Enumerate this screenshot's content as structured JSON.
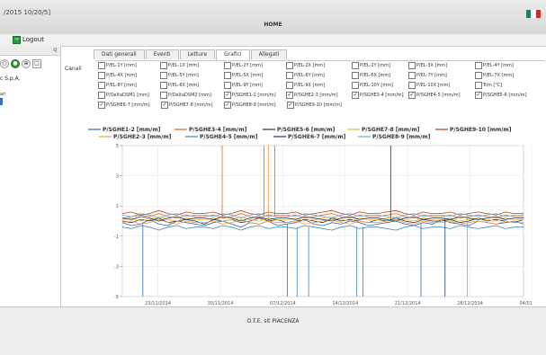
{
  "app": {
    "version": "/2015 10/20/5]",
    "home": "HOME",
    "flag_colors": [
      "#009246",
      "#ffffff",
      "#ce2b37"
    ]
  },
  "toolbar": {
    "cut_label": "i",
    "logout_label": "Logout"
  },
  "sidebar": {
    "close_glyph": "q",
    "tools": [
      "○",
      "●",
      "⊕",
      "□"
    ],
    "company": "c S.p.A.",
    "sub_label": "ari"
  },
  "tabs": [
    "Dati generali",
    "Eventi",
    "Letture",
    "Grafici",
    "Allegati"
  ],
  "active_tab": "Grafici",
  "channels": {
    "label": "Canali",
    "rows": [
      [
        {
          "label": "P/EL-1Y [mm]",
          "checked": false
        },
        {
          "label": "P/EL-1X [mm]",
          "checked": false
        },
        {
          "label": "P/EL-2Y [mm]",
          "checked": false
        },
        {
          "label": "P/EL-2X [mm]",
          "checked": false
        },
        {
          "label": "P/EL-2Y [mm]",
          "checked": false
        },
        {
          "label": "P/EL-3X [mm]",
          "checked": false
        },
        {
          "label": "P/EL-4Y [mm]",
          "checked": false
        }
      ],
      [
        {
          "label": "P/EL-4X [mm]",
          "checked": false
        },
        {
          "label": "P/EL-5Y [mm]",
          "checked": false
        },
        {
          "label": "P/EL-5X [mm]",
          "checked": false
        },
        {
          "label": "P/EL-6Y [mm]",
          "checked": false
        },
        {
          "label": "P/EL-6X [mm]",
          "checked": false
        },
        {
          "label": "P/EL-7Y [mm]",
          "checked": false
        },
        {
          "label": "P/EL-7X [mm]",
          "checked": false
        }
      ],
      [
        {
          "label": "P/EL-8Y [mm]",
          "checked": false
        },
        {
          "label": "P/EL-8X [mm]",
          "checked": false
        },
        {
          "label": "P/EL-9Y [mm]",
          "checked": false
        },
        {
          "label": "P/EL-9X [mm]",
          "checked": false
        },
        {
          "label": "P/EL-10Y [mm]",
          "checked": false
        },
        {
          "label": "P/EL-10X [mm]",
          "checked": false
        },
        {
          "label": "Tcm [°C]",
          "checked": false
        }
      ],
      [
        {
          "label": "P/DeltaDSM1 [mm]",
          "checked": false
        },
        {
          "label": "P/DeltaDSM2 [mm]",
          "checked": false
        },
        {
          "label": "P/SGHE1-2 [mm/m]",
          "checked": true
        },
        {
          "label": "P/SGHE2-3 [mm/m]",
          "checked": true
        },
        {
          "label": "P/SGHE3-4 [mm/m]",
          "checked": true
        },
        {
          "label": "P/SGHE4-5 [mm/m]",
          "checked": true
        },
        {
          "label": "P/SGHE5-6 [mm/m]",
          "checked": true
        }
      ],
      [
        {
          "label": "P/SGHE6-7 [mm/m]",
          "checked": true
        },
        {
          "label": "P/SGHE7-8 [mm/m]",
          "checked": true
        },
        {
          "label": "P/SGHE8-9 [mm/m]",
          "checked": true
        },
        {
          "label": "P/SGHE9-10 [mm/m]",
          "checked": true
        }
      ]
    ]
  },
  "chart_data": {
    "type": "line",
    "title": "",
    "xlabel": "",
    "ylabel": "",
    "ylim": [
      -5,
      5
    ],
    "yticks": [
      -5,
      -3,
      -1,
      1,
      3,
      5
    ],
    "x_tick_labels": [
      "23/11/2014",
      "30/11/2014",
      "07/12/2014",
      "14/12/2014",
      "21/12/2014",
      "28/12/2014",
      "04/01/2015"
    ],
    "grid": true,
    "legend_position": "top",
    "legend_rows": [
      [
        "P/SGHE1-2 [mm/m]",
        "P/SGHE3-4 [mm/m]",
        "P/SGHE5-6 [mm/m]",
        "P/SGHE7-8 [mm/m]",
        "P/SGHE9-10 [mm/m]"
      ],
      [
        "P/SGHE2-3 [mm/m]",
        "P/SGHE4-5 [mm/m]",
        "P/SGHE6-7 [mm/m]",
        "P/SGHE8-9 [mm/m]"
      ]
    ],
    "series": [
      {
        "name": "P/SGHE1-2 [mm/m]",
        "color": "#2b6cb0",
        "base": -0.2,
        "spikes": [
          {
            "day": 2.3,
            "to": -5
          },
          {
            "day": 18.5,
            "to": -5
          },
          {
            "day": 33.5,
            "to": -5
          }
        ],
        "values": [
          -0.1,
          -0.3,
          -0.2,
          0.1,
          -0.2,
          -0.3,
          0.0,
          -0.1,
          -0.2,
          -0.3,
          -0.1,
          0.0,
          -0.2,
          -0.4,
          -0.1,
          -0.2,
          0.0,
          -0.3,
          -0.2,
          -0.1,
          0.1,
          -0.2,
          -0.3,
          -0.1,
          -0.2,
          0.0,
          -0.1,
          -0.3,
          -0.2,
          -0.1,
          0.0,
          -0.2,
          -0.3,
          -0.1,
          -0.2,
          0.1,
          -0.1,
          -0.2,
          -0.3,
          0.0,
          -0.1,
          -0.2,
          -0.1,
          0.0,
          -0.2
        ]
      },
      {
        "name": "P/SGHE3-4 [mm/m]",
        "color": "#e0642a",
        "base": 0.3,
        "spikes": [
          {
            "day": 11.2,
            "to": 5
          },
          {
            "day": 15.9,
            "to": 5
          },
          {
            "day": 17.1,
            "to": 5
          }
        ],
        "values": [
          0.2,
          0.3,
          0.4,
          0.3,
          0.5,
          0.3,
          0.2,
          0.4,
          0.3,
          0.3,
          0.4,
          0.2,
          0.3,
          0.5,
          0.3,
          0.2,
          0.4,
          0.3,
          0.3,
          0.4,
          0.2,
          0.3,
          0.4,
          0.5,
          0.3,
          0.2,
          0.4,
          0.3,
          0.3,
          0.4,
          0.5,
          0.3,
          0.2,
          0.4,
          0.3,
          0.3,
          0.4,
          0.2,
          0.3,
          0.4,
          0.3,
          0.2,
          0.4,
          0.3,
          0.3
        ]
      },
      {
        "name": "P/SGHE5-6 [mm/m]",
        "color": "#333333",
        "base": 0.0,
        "spikes": [
          {
            "day": 30.1,
            "to": 5
          }
        ],
        "values": [
          0.0,
          -0.1,
          0.1,
          0.0,
          0.2,
          -0.1,
          0.0,
          0.1,
          0.0,
          -0.2,
          0.1,
          0.0,
          0.1,
          -0.1,
          0.0,
          0.2,
          0.0,
          0.1,
          -0.1,
          0.0,
          0.1,
          0.0,
          -0.1,
          0.2,
          0.0,
          0.1,
          0.0,
          -0.1,
          0.1,
          0.0,
          0.2,
          0.0,
          -0.1,
          0.1,
          0.0,
          0.0,
          0.1,
          -0.1,
          0.0,
          0.2,
          0.0,
          0.1,
          0.0,
          -0.1,
          0.1
        ]
      },
      {
        "name": "P/SGHE7-8 [mm/m]",
        "color": "#e3b341",
        "base": 0.1,
        "spikes": [],
        "values": [
          0.1,
          0.2,
          0.0,
          0.1,
          0.3,
          0.1,
          0.0,
          0.2,
          0.1,
          0.1,
          0.2,
          0.0,
          0.1,
          0.3,
          0.1,
          0.0,
          0.2,
          0.1,
          0.1,
          0.2,
          0.0,
          0.1,
          0.2,
          0.3,
          0.1,
          0.0,
          0.2,
          0.1,
          0.1,
          0.2,
          0.3,
          0.1,
          0.0,
          0.2,
          0.1,
          0.1,
          0.2,
          0.0,
          0.1,
          0.2,
          0.1,
          0.0,
          0.2,
          0.1,
          0.1
        ]
      },
      {
        "name": "P/SGHE9-10 [mm/m]",
        "color": "#b7410e",
        "base": 0.5,
        "spikes": [],
        "values": [
          0.5,
          0.6,
          0.4,
          0.5,
          0.7,
          0.5,
          0.4,
          0.6,
          0.5,
          0.5,
          0.6,
          0.4,
          0.5,
          0.7,
          0.5,
          0.4,
          0.6,
          0.5,
          0.5,
          0.6,
          0.4,
          0.5,
          0.6,
          0.7,
          0.5,
          0.4,
          0.6,
          0.5,
          0.5,
          0.6,
          0.7,
          0.5,
          0.4,
          0.6,
          0.5,
          0.5,
          0.6,
          0.4,
          0.5,
          0.6,
          0.5,
          0.4,
          0.6,
          0.5,
          0.5
        ]
      },
      {
        "name": "P/SGHE2-3 [mm/m]",
        "color": "#f29d38",
        "base": -0.1,
        "spikes": [
          {
            "day": 16.4,
            "to": 5
          }
        ],
        "values": [
          -0.1,
          0.0,
          -0.2,
          -0.1,
          0.1,
          -0.1,
          -0.2,
          0.0,
          -0.1,
          -0.1,
          0.0,
          -0.2,
          -0.1,
          0.1,
          -0.1,
          -0.2,
          0.0,
          -0.1,
          -0.1,
          0.0,
          -0.2,
          -0.1,
          0.0,
          0.1,
          -0.1,
          -0.2,
          0.0,
          -0.1,
          -0.1,
          0.0,
          0.1,
          -0.1,
          -0.2,
          0.0,
          -0.1,
          -0.1,
          0.0,
          -0.2,
          -0.1,
          0.0,
          -0.1,
          -0.2,
          0.0,
          -0.1,
          -0.1
        ]
      },
      {
        "name": "P/SGHE4-5 [mm/m]",
        "color": "#3b82c4",
        "base": -0.4,
        "spikes": [
          {
            "day": 19.6,
            "to": -5
          },
          {
            "day": 20.9,
            "to": -5
          },
          {
            "day": 26.3,
            "to": -5
          },
          {
            "day": 27.0,
            "to": -5
          }
        ],
        "values": [
          -0.4,
          -0.5,
          -0.3,
          -0.4,
          -0.6,
          -0.4,
          -0.3,
          -0.5,
          -0.4,
          -0.4,
          -0.5,
          -0.3,
          -0.4,
          -0.6,
          -0.4,
          -0.3,
          -0.5,
          -0.4,
          -0.4,
          -0.5,
          -0.3,
          -0.4,
          -0.5,
          -0.6,
          -0.4,
          -0.3,
          -0.5,
          -0.4,
          -0.4,
          -0.5,
          -0.6,
          -0.4,
          -0.3,
          -0.5,
          -0.4,
          -0.4,
          -0.5,
          -0.3,
          -0.4,
          -0.5,
          -0.4,
          -0.3,
          -0.5,
          -0.4,
          -0.4
        ]
      },
      {
        "name": "P/SGHE6-7 [mm/m]",
        "color": "#1f3b63",
        "base": 0.2,
        "spikes": [
          {
            "day": 36.2,
            "to": -5
          }
        ],
        "values": [
          0.2,
          0.1,
          0.3,
          0.2,
          0.0,
          0.2,
          0.3,
          0.1,
          0.2,
          0.2,
          0.1,
          0.3,
          0.2,
          0.0,
          0.2,
          0.3,
          0.1,
          0.2,
          0.2,
          0.1,
          0.3,
          0.2,
          0.1,
          0.0,
          0.2,
          0.3,
          0.1,
          0.2,
          0.2,
          0.1,
          0.0,
          0.2,
          0.3,
          0.1,
          0.2,
          0.2,
          0.1,
          0.3,
          0.2,
          0.1,
          0.2,
          0.3,
          0.1,
          0.2,
          0.2
        ]
      },
      {
        "name": "P/SGHE8-9 [mm/m]",
        "color": "#6aaed6",
        "base": 0.4,
        "spikes": [
          {
            "day": 38.7,
            "to": -5
          }
        ],
        "values": [
          0.4,
          0.3,
          0.5,
          0.4,
          0.2,
          0.4,
          0.5,
          0.3,
          0.4,
          0.4,
          0.3,
          0.5,
          0.4,
          0.2,
          0.4,
          0.5,
          0.3,
          0.4,
          0.4,
          0.3,
          0.5,
          0.4,
          0.3,
          0.2,
          0.4,
          0.5,
          0.3,
          0.4,
          0.4,
          0.3,
          0.2,
          0.4,
          0.5,
          0.3,
          0.4,
          0.4,
          0.3,
          0.5,
          0.4,
          0.3,
          0.4,
          0.5,
          0.3,
          0.4,
          0.4
        ]
      }
    ]
  },
  "footer": {
    "text": "O.T.E. sit PIACENZA"
  }
}
